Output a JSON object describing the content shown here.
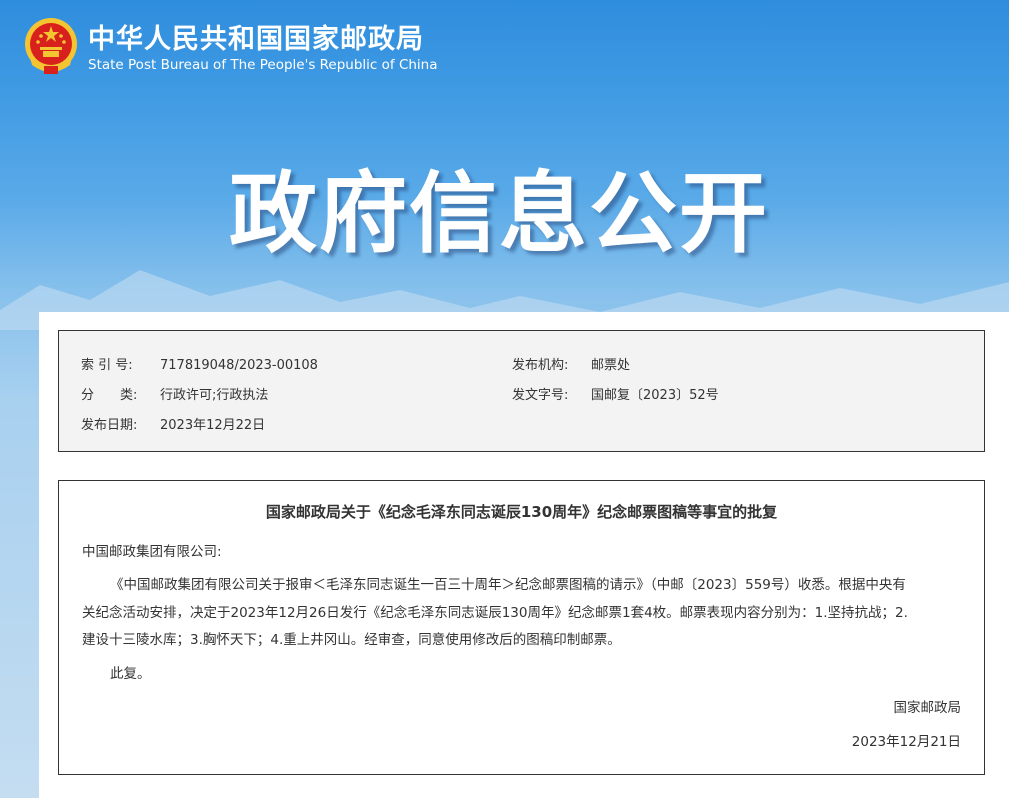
{
  "header": {
    "org_name_cn": "中华人民共和国国家邮政局",
    "org_name_en": "State Post Bureau of The People's Republic of China",
    "hero_title": "政府信息公开"
  },
  "meta": {
    "index_label": "索 引 号:",
    "index_value": "717819048/2023-00108",
    "agency_label": "发布机构:",
    "agency_value": "邮票处",
    "category_label": "分　　类:",
    "category_value": "行政许可;行政执法",
    "doc_no_label": "发文字号:",
    "doc_no_value": "国邮复〔2023〕52号",
    "date_label": "发布日期:",
    "date_value": "2023年12月22日"
  },
  "document": {
    "title": "国家邮政局关于《纪念毛泽东同志诞辰130周年》纪念邮票图稿等事宜的批复",
    "addressee": "中国邮政集团有限公司:",
    "body_lines": [
      "《中国邮政集团有限公司关于报审＜毛泽东同志诞生一百三十周年＞纪念邮票图稿的请示》（中邮〔2023〕559号）收悉。根据中央有",
      "关纪念活动安排，决定于2023年12月26日发行《纪念毛泽东同志诞辰130周年》纪念邮票1套4枚。邮票表现内容分别为：1.坚持抗战；2.",
      "建设十三陵水库；3.胸怀天下；4.重上井冈山。经审查，同意使用修改后的图稿印制邮票。"
    ],
    "closing": "此复。",
    "signature": "国家邮政局",
    "signed_date": "2023年12月21日"
  },
  "colors": {
    "banner_blue": "#2f8ddd",
    "emblem_red": "#d8201c",
    "emblem_gold": "#f4c531",
    "border": "#333333"
  }
}
